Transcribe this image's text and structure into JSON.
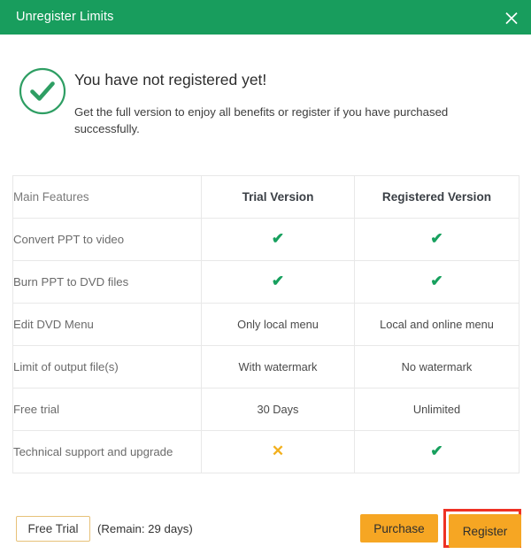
{
  "window": {
    "title": "Unregister Limits",
    "close_label": "×",
    "header_bg": "#189d5d"
  },
  "intro": {
    "icon": "check-circle-icon",
    "heading": "You have not registered yet!",
    "description": "Get the full version to enjoy all benefits or register if you have purchased successfully."
  },
  "table": {
    "headers": {
      "feature": "Main Features",
      "trial": "Trial Version",
      "registered": "Registered Version"
    },
    "rows": [
      {
        "feature": "Convert PPT to video",
        "trial": "✔",
        "trial_type": "check",
        "registered": "✔",
        "registered_type": "check"
      },
      {
        "feature": "Burn PPT to DVD files",
        "trial": "✔",
        "trial_type": "check",
        "registered": "✔",
        "registered_type": "check"
      },
      {
        "feature": "Edit DVD Menu",
        "trial": "Only local menu",
        "trial_type": "text",
        "registered": "Local and online menu",
        "registered_type": "text"
      },
      {
        "feature": "Limit of output file(s)",
        "trial": "With watermark",
        "trial_type": "text",
        "registered": "No watermark",
        "registered_type": "text"
      },
      {
        "feature": "Free trial",
        "trial": "30 Days",
        "trial_type": "text",
        "registered": "Unlimited",
        "registered_type": "text"
      },
      {
        "feature": "Technical support and upgrade",
        "trial": "✕",
        "trial_type": "cross",
        "registered": "✔",
        "registered_type": "check"
      }
    ]
  },
  "footer": {
    "free_trial_label": "Free Trial",
    "remain_text": "(Remain: 29 days)",
    "purchase_label": "Purchase",
    "register_label": "Register",
    "highlight_color": "#ee3124",
    "accent_color": "#f6a623",
    "check_color": "#17a05e",
    "cross_color": "#f2b01e"
  }
}
